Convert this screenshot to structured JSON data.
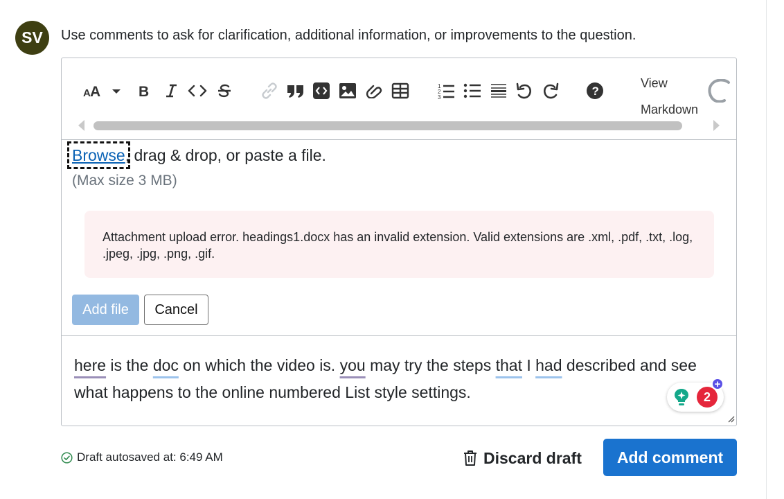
{
  "user": {
    "initials": "SV"
  },
  "comment_hint": "Use comments to ask for clarification, additional information, or improvements to the question.",
  "toolbar": {
    "icons": [
      "text-size-icon",
      "bold-icon",
      "italic-icon",
      "code-icon",
      "strikethrough-icon",
      "link-icon",
      "blockquote-icon",
      "code-block-icon",
      "image-icon",
      "snippet-icon",
      "table-icon",
      "ordered-list-icon",
      "unordered-list-icon",
      "horizontal-rule-icon",
      "undo-icon",
      "redo-icon",
      "help-icon"
    ],
    "view_markdown_line1": "View",
    "view_markdown_line2": "Markdown"
  },
  "upload": {
    "browse_label": "Browse",
    "rest_text": ", drag & drop, or paste a file.",
    "max_size": "(Max size 3 MB)",
    "error_message": "Attachment upload error. headings1.docx has an invalid extension. Valid extensions are .xml, .pdf, .txt, .log, .jpeg, .jpg, .png, .gif.",
    "add_file_label": "Add file",
    "cancel_label": "Cancel"
  },
  "body_text": {
    "w1": "here",
    "t1": " is the ",
    "w2": "doc",
    "t2": " on which the video is. ",
    "w3": "you",
    "t3": " may try the steps ",
    "w4": "that",
    "t4": " I ",
    "w5": "had",
    "t5": " described and see what happens to the online numbered List style settings."
  },
  "grammar": {
    "count": "2",
    "plus": "+"
  },
  "footer": {
    "draft_status": "Draft autosaved at: 6:49 AM",
    "discard_label": "Discard draft",
    "submit_label": "Add comment"
  },
  "colors": {
    "avatar_bg": "#3e3f12",
    "primary": "#1a73cf",
    "primary_disabled": "#93b9e1",
    "error_bg": "#fdf1f2",
    "link": "#0a62b5",
    "success": "#2f8a4e"
  }
}
